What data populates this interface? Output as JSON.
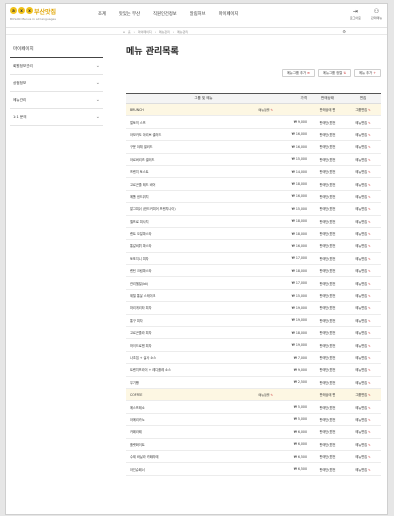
{
  "header": {
    "logo_badges": [
      "a",
      "x",
      "x"
    ],
    "logo_name": "부산맛집",
    "logo_sub": "BUSAN Menus in all languages",
    "nav": [
      "조계",
      "맛있는 부산",
      "직원인건정보",
      "알림허브",
      "마이페이지"
    ],
    "util": [
      {
        "icon": "logout-icon",
        "glyph": "⇥",
        "label": "로그아웃"
      },
      {
        "icon": "user-icon",
        "glyph": "⚇",
        "label": "관리메뉴"
      }
    ]
  },
  "breadcrumb": [
    "홈",
    "마이페이지",
    "메뉴관리",
    "메뉴관리"
  ],
  "sidebar": {
    "title": "마이페이지",
    "items": [
      "회원정보관리",
      "상점정보",
      "메뉴관리",
      "1:1 문의"
    ]
  },
  "main": {
    "title": "메뉴 관리목록",
    "buttons": [
      "메뉴그룹 추가",
      "메뉴그룹 정렬",
      "메뉴 추가"
    ],
    "columns": [
      "그룹 및 메뉴",
      "가격",
      "판매상태",
      "편집"
    ],
    "rows": [
      {
        "type": "group",
        "name": "BRUNCH",
        "sub": "메뉴정렬",
        "price": "",
        "status": "판매상태 편",
        "edit": "그룹편집"
      },
      {
        "type": "item",
        "name": "얼토히 스프",
        "price": "₩ 9,000",
        "status": "판매단(원전",
        "edit": "메뉴편집"
      },
      {
        "type": "item",
        "name": "아보카도 아리브 샐러드",
        "price": "₩ 16,000",
        "status": "판매단(원전",
        "edit": "메뉴편집"
      },
      {
        "type": "item",
        "name": "구운 야채 샐러드",
        "price": "₩ 16,000",
        "status": "판매단(원전",
        "edit": "메뉴편집"
      },
      {
        "type": "item",
        "name": "아르버리즈 샐러드",
        "price": "₩ 15,000",
        "status": "판매단(원전",
        "edit": "메뉴편집"
      },
      {
        "type": "item",
        "name": "프렌치 토스트",
        "price": "₩ 14,000",
        "status": "판매단(원전",
        "edit": "메뉴편집"
      },
      {
        "type": "item",
        "name": "고르곤졸 레드 비어",
        "price": "₩ 18,000",
        "status": "판매단(원전",
        "edit": "메뉴편집"
      },
      {
        "type": "item",
        "name": "에톨 샌드위치",
        "price": "₩ 16,000",
        "status": "판매단(원전",
        "edit": "메뉴편집"
      },
      {
        "type": "item",
        "name": "알그피쉬 (한드커피어 프렌치나이)",
        "price": "₩ 15,000",
        "status": "판매단(원전",
        "edit": "메뉴편집"
      },
      {
        "type": "item",
        "name": "엘프로 피사치",
        "price": "₩ 18,000",
        "status": "판매단(원전",
        "edit": "메뉴편집"
      },
      {
        "type": "item",
        "name": "랜트 오일파스타",
        "price": "₩ 18,000",
        "status": "판매단(원전",
        "edit": "메뉴편집"
      },
      {
        "type": "item",
        "name": "통갈비튀 파스타",
        "price": "₩ 16,000",
        "status": "판매단(원전",
        "edit": "메뉴편집"
      },
      {
        "type": "item",
        "name": "토포지니 피자",
        "price": "₩ 17,000",
        "status": "판매단(원전",
        "edit": "메뉴편집"
      },
      {
        "type": "item",
        "name": "렌틴 크림파스타",
        "price": "₩ 18,000",
        "status": "판매단(원전",
        "edit": "메뉴편집"
      },
      {
        "type": "item",
        "name": "관리헬릴(Idi)",
        "price": "₩ 17,000",
        "status": "판매단(원전",
        "edit": "메뉴편집"
      },
      {
        "type": "item",
        "name": "제철 통살 스테이크",
        "price": "₩ 15,000",
        "status": "판매단(원전",
        "edit": "메뉴편집"
      },
      {
        "type": "item",
        "name": "마리게리타 피자",
        "price": "₩ 19,000",
        "status": "판매단(원전",
        "edit": "메뉴편집"
      },
      {
        "type": "item",
        "name": "통구 피자",
        "price": "₩ 19,000",
        "status": "판매단(원전",
        "edit": "메뉴편집"
      },
      {
        "type": "item",
        "name": "고르곤졸라 피자",
        "price": "₩ 18,000",
        "status": "판매단(원전",
        "edit": "메뉴편집"
      },
      {
        "type": "item",
        "name": "하이드로젠 피자",
        "price": "₩ 19,000",
        "status": "판매단(원전",
        "edit": "메뉴편집"
      },
      {
        "type": "item",
        "name": "나초칩 + 살사 소스",
        "price": "₩ 7,000",
        "status": "판매단(원전",
        "edit": "메뉴편집"
      },
      {
        "type": "item",
        "name": "트렌치프라이 + 레디플레 소스",
        "price": "₩ 9,000",
        "status": "판매단(원전",
        "edit": "메뉴편집"
      },
      {
        "type": "item",
        "name": "우기빵",
        "price": "₩ 2,500",
        "status": "판매단(원전",
        "edit": "메뉴편집"
      },
      {
        "type": "group",
        "name": "COFFEE",
        "sub": "메뉴정렬",
        "price": "",
        "status": "판매상태 편",
        "edit": "그룹편집"
      },
      {
        "type": "item",
        "name": "에스프레소",
        "price": "₩ 5,000",
        "status": "판매단(원전",
        "edit": "메뉴편집"
      },
      {
        "type": "item",
        "name": "아메리카노",
        "price": "₩ 5,000",
        "status": "판매단(원전",
        "edit": "메뉴편집"
      },
      {
        "type": "item",
        "name": "카페라떼",
        "price": "₩ 6,000",
        "status": "판매단(원전",
        "edit": "메뉴편집"
      },
      {
        "type": "item",
        "name": "플랫화이트",
        "price": "₩ 6,000",
        "status": "판매단(원전",
        "edit": "메뉴편집"
      },
      {
        "type": "item",
        "name": "수제 바닐라 카페라떼",
        "price": "₩ 6,500",
        "status": "판매단(원전",
        "edit": "메뉴편집"
      },
      {
        "type": "item",
        "name": "아인슈페너",
        "price": "₩ 6,500",
        "status": "판매단(원전",
        "edit": "메뉴편집"
      }
    ]
  },
  "colors": {
    "accent": "#f2c31b",
    "edit_red": "#d04040",
    "group_bg": "#fdf7e3"
  }
}
